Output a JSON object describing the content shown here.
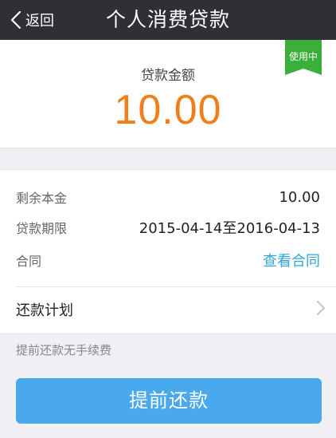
{
  "nav": {
    "back_label": "返回",
    "title": "个人消费贷款"
  },
  "loan": {
    "amount_label": "贷款金额",
    "amount_value": "10.00",
    "status_badge": "使用中",
    "status_color": "#3cae3a",
    "amount_color": "#f07f1a"
  },
  "details": {
    "remaining_principal_label": "剩余本金",
    "remaining_principal_value": "10.00",
    "term_label": "贷款期限",
    "term_value": "2015-04-14至2016-04-13",
    "contract_label": "合同",
    "contract_link": "查看合同"
  },
  "plan": {
    "label": "还款计划",
    "icon": "chevron-right-icon"
  },
  "note": "提前还款无手续费",
  "cta": {
    "label": "提前还款",
    "color": "#4aa9ec"
  }
}
